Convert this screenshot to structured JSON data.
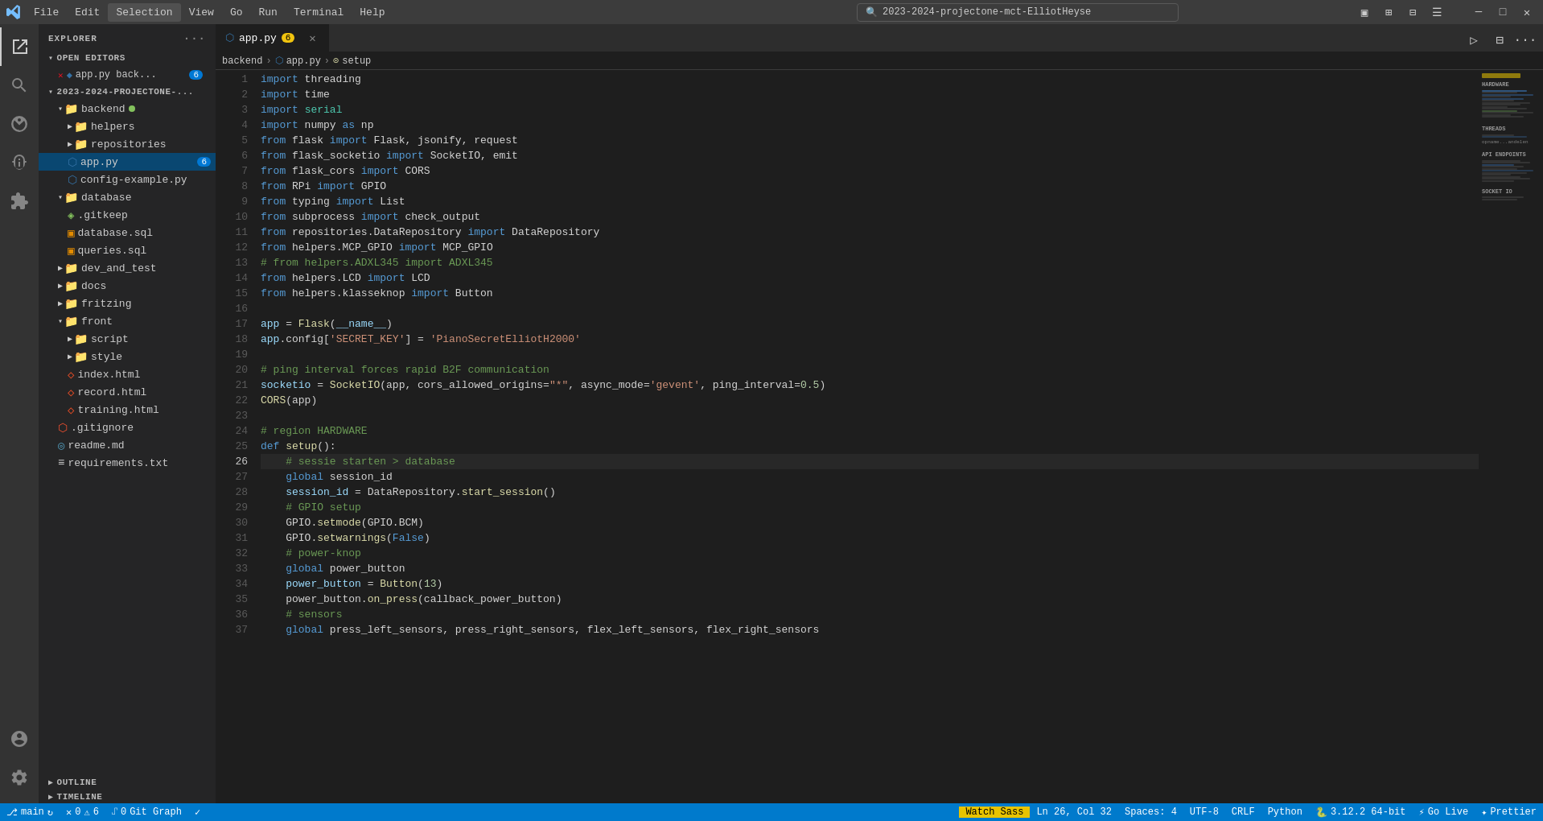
{
  "titlebar": {
    "search_text": "2023-2024-projectone-mct-ElliotHeyse",
    "menu_items": [
      "File",
      "Edit",
      "Selection",
      "View",
      "Go",
      "Run",
      "Terminal",
      "Help"
    ]
  },
  "tabs": [
    {
      "label": "app.py",
      "modified": true,
      "count": 6,
      "active": true
    }
  ],
  "breadcrumb": {
    "parts": [
      "backend",
      ">",
      "app.py",
      ">",
      "setup"
    ]
  },
  "sidebar": {
    "title": "EXPLORER",
    "sections": {
      "open_editors": {
        "label": "OPEN EDITORS",
        "items": [
          {
            "label": "app.py back...",
            "badge": 6,
            "icon": "py"
          }
        ]
      },
      "project": {
        "label": "2023-2024-PROJECTONE-...",
        "folders": [
          {
            "name": "backend",
            "dot": true,
            "children": [
              {
                "name": "helpers",
                "type": "folder"
              },
              {
                "name": "repositories",
                "type": "folder"
              },
              {
                "name": "app.py",
                "type": "py",
                "badge": 6,
                "active": true
              },
              {
                "name": "config-example.py",
                "type": "py"
              }
            ]
          },
          {
            "name": "database",
            "children": [
              {
                "name": ".gitkeep",
                "type": "git"
              },
              {
                "name": "database.sql",
                "type": "sql"
              },
              {
                "name": "queries.sql",
                "type": "sql"
              }
            ]
          },
          {
            "name": "dev_and_test",
            "type": "folder"
          },
          {
            "name": "docs",
            "type": "folder"
          },
          {
            "name": "fritzing",
            "type": "folder"
          },
          {
            "name": "front",
            "children": [
              {
                "name": "script",
                "type": "folder"
              },
              {
                "name": "style",
                "type": "folder"
              },
              {
                "name": "index.html",
                "type": "html"
              },
              {
                "name": "record.html",
                "type": "html"
              },
              {
                "name": "training.html",
                "type": "html"
              }
            ]
          },
          {
            "name": ".gitignore",
            "type": "git"
          },
          {
            "name": "readme.md",
            "type": "md"
          },
          {
            "name": "requirements.txt",
            "type": "txt"
          }
        ]
      }
    },
    "outline": {
      "label": "OUTLINE"
    },
    "timeline": {
      "label": "TIMELINE"
    }
  },
  "code_lines": [
    {
      "num": 1,
      "tokens": [
        {
          "t": "kw",
          "v": "import"
        },
        {
          "t": "plain",
          "v": " threading"
        }
      ]
    },
    {
      "num": 2,
      "tokens": [
        {
          "t": "kw",
          "v": "import"
        },
        {
          "t": "plain",
          "v": " time"
        }
      ]
    },
    {
      "num": 3,
      "tokens": [
        {
          "t": "kw",
          "v": "import"
        },
        {
          "t": "plain",
          "v": " "
        },
        {
          "t": "mod",
          "v": "serial"
        }
      ]
    },
    {
      "num": 4,
      "tokens": [
        {
          "t": "kw",
          "v": "import"
        },
        {
          "t": "plain",
          "v": " numpy "
        },
        {
          "t": "kw",
          "v": "as"
        },
        {
          "t": "plain",
          "v": " np"
        }
      ]
    },
    {
      "num": 5,
      "tokens": [
        {
          "t": "kw",
          "v": "from"
        },
        {
          "t": "plain",
          "v": " flask "
        },
        {
          "t": "kw",
          "v": "import"
        },
        {
          "t": "plain",
          "v": " Flask, jsonify, request"
        }
      ]
    },
    {
      "num": 6,
      "tokens": [
        {
          "t": "kw",
          "v": "from"
        },
        {
          "t": "plain",
          "v": " flask_socketio "
        },
        {
          "t": "kw",
          "v": "import"
        },
        {
          "t": "plain",
          "v": " SocketIO, emit"
        }
      ]
    },
    {
      "num": 7,
      "tokens": [
        {
          "t": "kw",
          "v": "from"
        },
        {
          "t": "plain",
          "v": " flask_cors "
        },
        {
          "t": "kw",
          "v": "import"
        },
        {
          "t": "plain",
          "v": " CORS"
        }
      ]
    },
    {
      "num": 8,
      "tokens": [
        {
          "t": "kw",
          "v": "from"
        },
        {
          "t": "plain",
          "v": " RPi "
        },
        {
          "t": "kw",
          "v": "import"
        },
        {
          "t": "plain",
          "v": " GPIO"
        }
      ]
    },
    {
      "num": 9,
      "tokens": [
        {
          "t": "kw",
          "v": "from"
        },
        {
          "t": "plain",
          "v": " typing "
        },
        {
          "t": "kw",
          "v": "import"
        },
        {
          "t": "plain",
          "v": " List"
        }
      ]
    },
    {
      "num": 10,
      "tokens": [
        {
          "t": "kw",
          "v": "from"
        },
        {
          "t": "plain",
          "v": " subprocess "
        },
        {
          "t": "kw",
          "v": "import"
        },
        {
          "t": "plain",
          "v": " check_output"
        }
      ]
    },
    {
      "num": 11,
      "tokens": [
        {
          "t": "kw",
          "v": "from"
        },
        {
          "t": "plain",
          "v": " repositories.DataRepository "
        },
        {
          "t": "kw",
          "v": "import"
        },
        {
          "t": "plain",
          "v": " DataRepository"
        }
      ]
    },
    {
      "num": 12,
      "tokens": [
        {
          "t": "kw",
          "v": "from"
        },
        {
          "t": "plain",
          "v": " helpers.MCP_GPIO "
        },
        {
          "t": "kw",
          "v": "import"
        },
        {
          "t": "plain",
          "v": " MCP_GPIO"
        }
      ]
    },
    {
      "num": 13,
      "tokens": [
        {
          "t": "cm",
          "v": "# from helpers.ADXL345 import ADXL345"
        }
      ]
    },
    {
      "num": 14,
      "tokens": [
        {
          "t": "kw",
          "v": "from"
        },
        {
          "t": "plain",
          "v": " helpers.LCD "
        },
        {
          "t": "kw",
          "v": "import"
        },
        {
          "t": "plain",
          "v": " LCD"
        }
      ]
    },
    {
      "num": 15,
      "tokens": [
        {
          "t": "kw",
          "v": "from"
        },
        {
          "t": "plain",
          "v": " helpers.klasseknop "
        },
        {
          "t": "kw",
          "v": "import"
        },
        {
          "t": "plain",
          "v": " Button"
        }
      ]
    },
    {
      "num": 16,
      "tokens": [
        {
          "t": "plain",
          "v": ""
        }
      ]
    },
    {
      "num": 17,
      "tokens": [
        {
          "t": "var",
          "v": "app"
        },
        {
          "t": "plain",
          "v": " = "
        },
        {
          "t": "fn",
          "v": "Flask"
        },
        {
          "t": "plain",
          "v": "("
        },
        {
          "t": "var",
          "v": "__name__"
        },
        {
          "t": "plain",
          "v": ")"
        }
      ]
    },
    {
      "num": 18,
      "tokens": [
        {
          "t": "var",
          "v": "app"
        },
        {
          "t": "plain",
          "v": ".config["
        },
        {
          "t": "str",
          "v": "'SECRET_KEY'"
        },
        {
          "t": "plain",
          "v": "] = "
        },
        {
          "t": "str",
          "v": "'PianoSecretElliotH2000'"
        }
      ]
    },
    {
      "num": 19,
      "tokens": [
        {
          "t": "plain",
          "v": ""
        }
      ]
    },
    {
      "num": 20,
      "tokens": [
        {
          "t": "cm",
          "v": "# ping interval forces rapid B2F communication"
        }
      ]
    },
    {
      "num": 21,
      "tokens": [
        {
          "t": "var",
          "v": "socketio"
        },
        {
          "t": "plain",
          "v": " = "
        },
        {
          "t": "fn",
          "v": "SocketIO"
        },
        {
          "t": "plain",
          "v": "(app, cors_allowed_origins="
        },
        {
          "t": "str",
          "v": "\"*\""
        },
        {
          "t": "plain",
          "v": ", async_mode="
        },
        {
          "t": "str",
          "v": "'gevent'"
        },
        {
          "t": "plain",
          "v": ", ping_interval="
        },
        {
          "t": "num",
          "v": "0.5"
        },
        {
          "t": "plain",
          "v": ")"
        }
      ]
    },
    {
      "num": 22,
      "tokens": [
        {
          "t": "fn",
          "v": "CORS"
        },
        {
          "t": "plain",
          "v": "(app)"
        }
      ]
    },
    {
      "num": 23,
      "tokens": [
        {
          "t": "plain",
          "v": ""
        }
      ]
    },
    {
      "num": 24,
      "tokens": [
        {
          "t": "cm",
          "v": "# region HARDWARE"
        }
      ]
    },
    {
      "num": 25,
      "tokens": [
        {
          "t": "kw",
          "v": "def"
        },
        {
          "t": "plain",
          "v": " "
        },
        {
          "t": "fn",
          "v": "setup"
        },
        {
          "t": "plain",
          "v": "():"
        }
      ]
    },
    {
      "num": 26,
      "tokens": [
        {
          "t": "plain",
          "v": "    "
        },
        {
          "t": "cm",
          "v": "# sessie starten > database"
        }
      ],
      "active": true
    },
    {
      "num": 27,
      "tokens": [
        {
          "t": "plain",
          "v": "    "
        },
        {
          "t": "kw",
          "v": "global"
        },
        {
          "t": "plain",
          "v": " session_id"
        }
      ]
    },
    {
      "num": 28,
      "tokens": [
        {
          "t": "plain",
          "v": "    "
        },
        {
          "t": "var",
          "v": "session_id"
        },
        {
          "t": "plain",
          "v": " = DataRepository."
        },
        {
          "t": "fn",
          "v": "start_session"
        },
        {
          "t": "plain",
          "v": "()"
        }
      ]
    },
    {
      "num": 29,
      "tokens": [
        {
          "t": "plain",
          "v": "    "
        },
        {
          "t": "cm",
          "v": "# GPIO setup"
        }
      ]
    },
    {
      "num": 30,
      "tokens": [
        {
          "t": "plain",
          "v": "    GPIO."
        },
        {
          "t": "fn",
          "v": "setmode"
        },
        {
          "t": "plain",
          "v": "(GPIO.BCM)"
        }
      ]
    },
    {
      "num": 31,
      "tokens": [
        {
          "t": "plain",
          "v": "    GPIO."
        },
        {
          "t": "fn",
          "v": "setwarnings"
        },
        {
          "t": "plain",
          "v": "("
        },
        {
          "t": "kw",
          "v": "False"
        },
        {
          "t": "plain",
          "v": ")"
        }
      ]
    },
    {
      "num": 32,
      "tokens": [
        {
          "t": "plain",
          "v": "    "
        },
        {
          "t": "cm",
          "v": "# power-knop"
        }
      ]
    },
    {
      "num": 33,
      "tokens": [
        {
          "t": "plain",
          "v": "    "
        },
        {
          "t": "kw",
          "v": "global"
        },
        {
          "t": "plain",
          "v": " power_button"
        }
      ]
    },
    {
      "num": 34,
      "tokens": [
        {
          "t": "plain",
          "v": "    "
        },
        {
          "t": "var",
          "v": "power_button"
        },
        {
          "t": "plain",
          "v": " = "
        },
        {
          "t": "fn",
          "v": "Button"
        },
        {
          "t": "plain",
          "v": "("
        },
        {
          "t": "num",
          "v": "13"
        },
        {
          "t": "plain",
          "v": ")"
        }
      ]
    },
    {
      "num": 35,
      "tokens": [
        {
          "t": "plain",
          "v": "    power_button."
        },
        {
          "t": "fn",
          "v": "on_press"
        },
        {
          "t": "plain",
          "v": "(callback_power_button)"
        }
      ]
    },
    {
      "num": 36,
      "tokens": [
        {
          "t": "plain",
          "v": "    "
        },
        {
          "t": "cm",
          "v": "# sensors"
        }
      ]
    },
    {
      "num": 37,
      "tokens": [
        {
          "t": "plain",
          "v": "    "
        },
        {
          "t": "kw",
          "v": "global"
        },
        {
          "t": "plain",
          "v": " press_left_sensors, press_right_sensors, flex_left_sensors, flex_right_sensors"
        }
      ]
    }
  ],
  "status_bar": {
    "branch": "main",
    "errors": "0",
    "warnings": "6",
    "watch_sass": "Watch Sass",
    "line": "Ln 26, Col 32",
    "spaces": "Spaces: 4",
    "encoding": "UTF-8",
    "eol": "CRLF",
    "language": "Python",
    "version": "3.12.2 64-bit",
    "go_live": "Go Live",
    "prettier": "Prettier"
  }
}
